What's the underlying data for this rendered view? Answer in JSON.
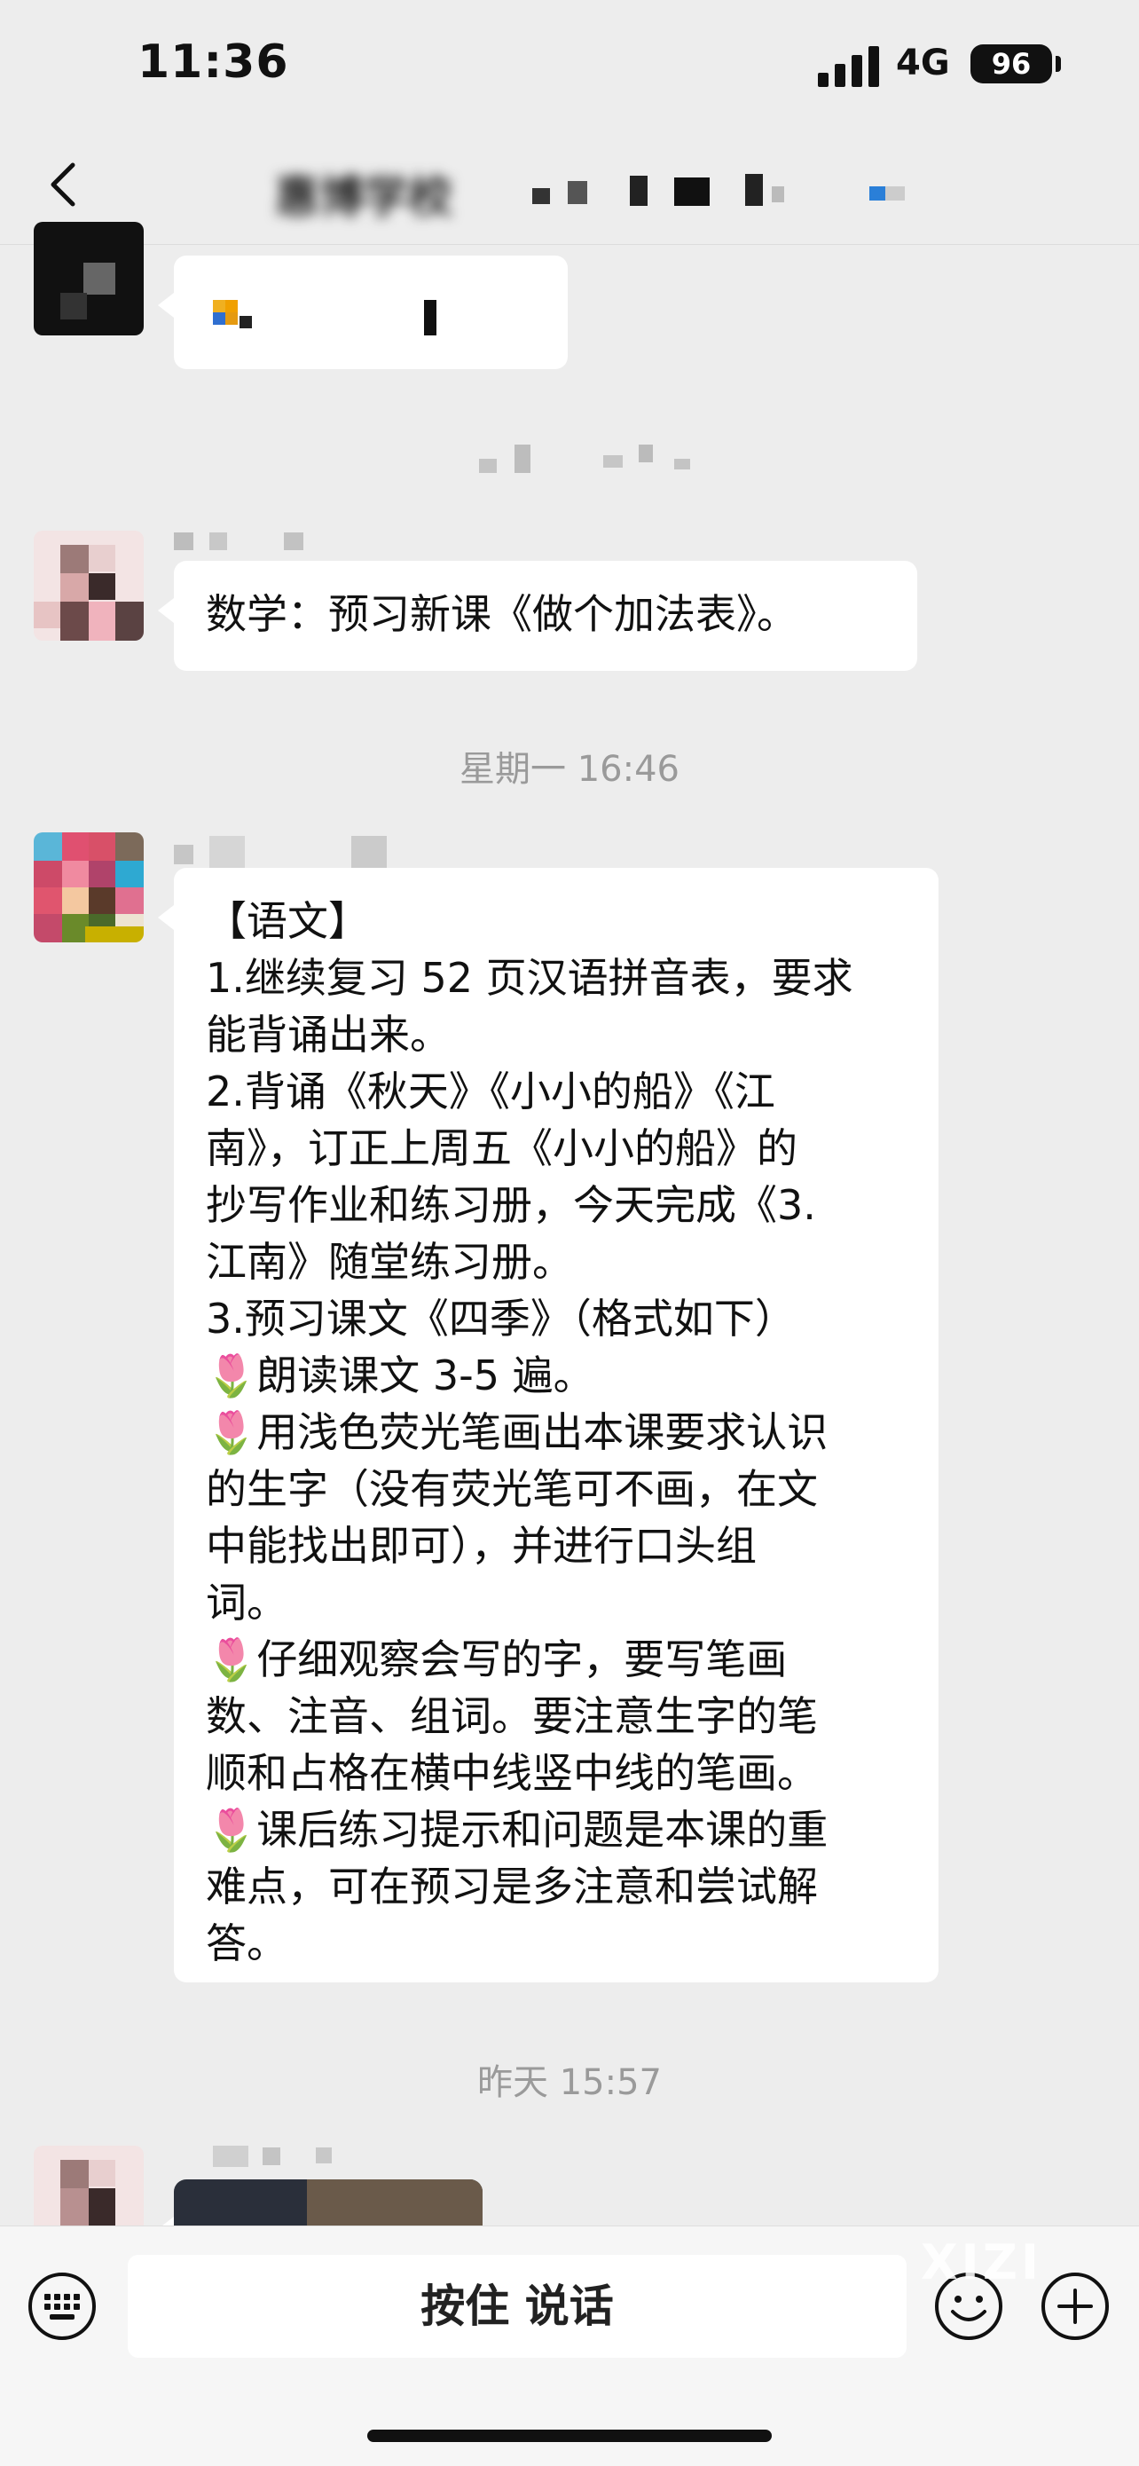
{
  "status": {
    "time": "11:36",
    "network": "4G",
    "battery": "96"
  },
  "nav": {
    "title": "惠博学校"
  },
  "messages": {
    "m2": {
      "text": "数学：预习新课《做个加法表》。"
    },
    "ts1": "星期一 16:46",
    "m3": {
      "lines": [
        "【语文】",
        "1.继续复习 52 页汉语拼音表，要求",
        "能背诵出来。",
        "2.背诵《秋天》《小小的船》《江",
        "南》，订正上周五《小小的船》的",
        "抄写作业和练习册，今天完成《3.",
        "江南》随堂练习册。",
        "3.预习课文《四季》（格式如下）",
        "🌷朗读课文 3-5 遍。",
        "🌷用浅色荧光笔画出本课要求认识",
        "的生字（没有荧光笔可不画，在文",
        "中能找出即可），并进行口头组",
        "词。",
        "🌷仔细观察会写的字，要写笔画",
        "数、注音、组词。要注意生字的笔",
        "顺和占格在横中线竖中线的笔画。",
        "🌷课后练习提示和问题是本课的重",
        "难点，可在预习是多注意和尝试解",
        "答。"
      ]
    },
    "ts2": "昨天 15:57"
  },
  "bottom": {
    "voice_label": "按住 说话",
    "watermark": "XIZI"
  },
  "icons": {
    "back": "chevron-left-icon",
    "keyboard": "keyboard-icon",
    "emoji": "emoji-icon",
    "plus": "plus-icon"
  },
  "colors": {
    "background": "#ededed",
    "bubble": "#ffffff",
    "timestamp": "#9a9a9a"
  }
}
